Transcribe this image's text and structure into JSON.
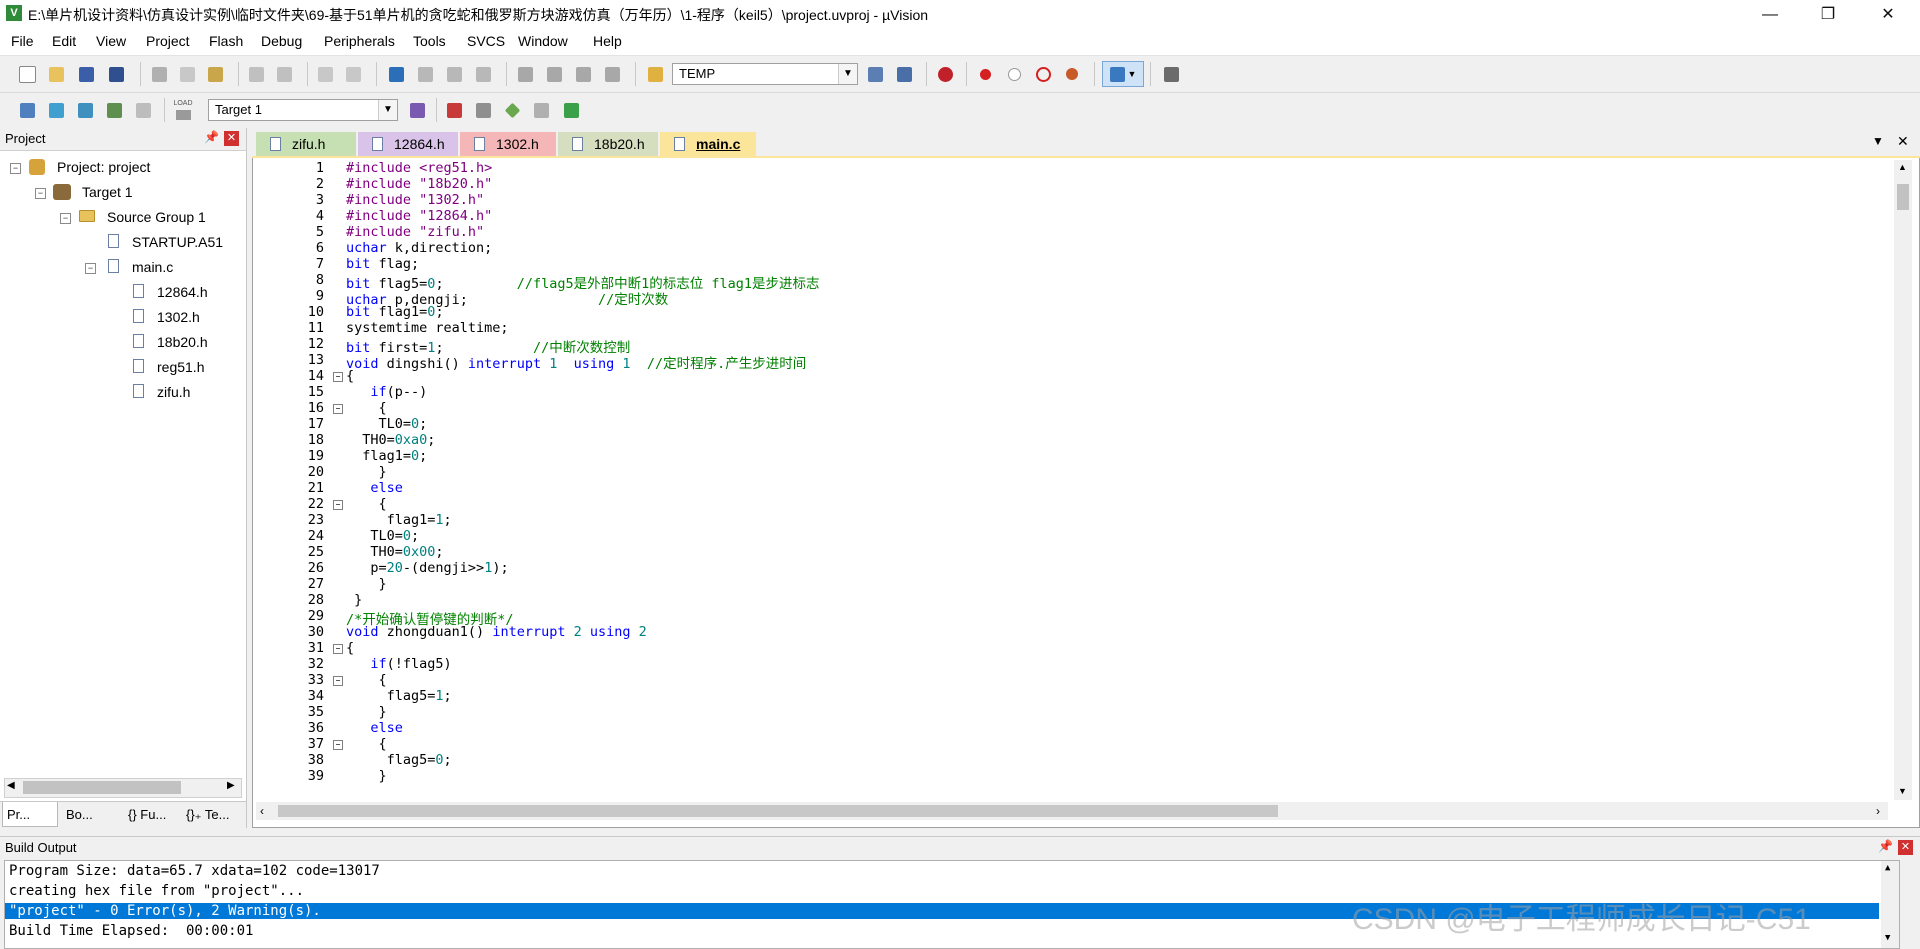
{
  "window": {
    "title": "E:\\单片机设计资料\\仿真设计实例\\临时文件夹\\69-基于51单片机的贪吃蛇和俄罗斯方块游戏仿真（万年历）\\1-程序（keil5）\\project.uvproj - µVision",
    "app_icon": "V",
    "minimize": "—",
    "maximize": "❐",
    "close": "✕"
  },
  "menu": [
    "File",
    "Edit",
    "View",
    "Project",
    "Flash",
    "Debug",
    "Peripherals",
    "Tools",
    "SVCS",
    "Window",
    "Help"
  ],
  "toolbar": {
    "find_text": "TEMP",
    "target": "Target 1",
    "load_label": "LOAD"
  },
  "project_panel": {
    "title": "Project",
    "tree": [
      {
        "label": "Project: project",
        "level": 0,
        "icon": "project-icon"
      },
      {
        "label": "Target 1",
        "level": 1,
        "icon": "target-icon"
      },
      {
        "label": "Source Group 1",
        "level": 2,
        "icon": "folder-icon"
      },
      {
        "label": "STARTUP.A51",
        "level": 3,
        "icon": "file-icon"
      },
      {
        "label": "main.c",
        "level": 3,
        "icon": "file-icon"
      },
      {
        "label": "12864.h",
        "level": 4,
        "icon": "file-icon"
      },
      {
        "label": "1302.h",
        "level": 4,
        "icon": "file-icon"
      },
      {
        "label": "18b20.h",
        "level": 4,
        "icon": "file-icon"
      },
      {
        "label": "reg51.h",
        "level": 4,
        "icon": "file-icon"
      },
      {
        "label": "zifu.h",
        "level": 4,
        "icon": "file-icon"
      }
    ],
    "bottom_tabs": [
      "Pr...",
      "Bo...",
      "{} Fu...",
      "{}₊ Te..."
    ]
  },
  "editor_tabs": [
    {
      "label": "zifu.h",
      "color": "#c6e0b4"
    },
    {
      "label": "12864.h",
      "color": "#d9c3e9"
    },
    {
      "label": "1302.h",
      "color": "#f4b6b6"
    },
    {
      "label": "18b20.h",
      "color": "#d5dfbf"
    },
    {
      "label": "main.c",
      "color": "#fbe59a",
      "active": true
    }
  ],
  "code": [
    {
      "n": "1",
      "t": "#include <reg51.h>"
    },
    {
      "n": "2",
      "t": "#include \"18b20.h\""
    },
    {
      "n": "3",
      "t": "#include \"1302.h\""
    },
    {
      "n": "4",
      "t": "#include \"12864.h\""
    },
    {
      "n": "5",
      "t": "#include \"zifu.h\""
    },
    {
      "n": "6",
      "t": "uchar k,direction;"
    },
    {
      "n": "7",
      "t": "bit flag;"
    },
    {
      "n": "8",
      "t": "bit flag5=0;         //flag5是外部中断1的标志位 flag1是步进标志"
    },
    {
      "n": "9",
      "t": "uchar p,dengji;                //定时次数"
    },
    {
      "n": "10",
      "t": "bit flag1=0;"
    },
    {
      "n": "11",
      "t": "systemtime realtime;"
    },
    {
      "n": "12",
      "t": "bit first=1;           //中断次数控制"
    },
    {
      "n": "13",
      "t": "void dingshi() interrupt 1  using 1  //定时程序.产生步进时间"
    },
    {
      "n": "14",
      "t": "{"
    },
    {
      "n": "15",
      "t": "   if(p--)"
    },
    {
      "n": "16",
      "t": "    {"
    },
    {
      "n": "17",
      "t": "    TL0=0;"
    },
    {
      "n": "18",
      "t": "  TH0=0xa0;"
    },
    {
      "n": "19",
      "t": "  flag1=0;"
    },
    {
      "n": "20",
      "t": "    }"
    },
    {
      "n": "21",
      "t": "   else"
    },
    {
      "n": "22",
      "t": "    {"
    },
    {
      "n": "23",
      "t": "     flag1=1;"
    },
    {
      "n": "24",
      "t": "   TL0=0;"
    },
    {
      "n": "25",
      "t": "   TH0=0x00;"
    },
    {
      "n": "26",
      "t": "   p=20-(dengji>>1);"
    },
    {
      "n": "27",
      "t": "    }"
    },
    {
      "n": "28",
      "t": " }"
    },
    {
      "n": "29",
      "t": "/*开始确认暂停键的判断*/"
    },
    {
      "n": "30",
      "t": "void zhongduan1() interrupt 2 using 2"
    },
    {
      "n": "31",
      "t": "{"
    },
    {
      "n": "32",
      "t": "   if(!flag5)"
    },
    {
      "n": "33",
      "t": "    {"
    },
    {
      "n": "34",
      "t": "     flag5=1;"
    },
    {
      "n": "35",
      "t": "    }"
    },
    {
      "n": "36",
      "t": "   else"
    },
    {
      "n": "37",
      "t": "    {"
    },
    {
      "n": "38",
      "t": "     flag5=0;"
    },
    {
      "n": "39",
      "t": "    }"
    }
  ],
  "build_output": {
    "title": "Build Output",
    "lines": [
      "Program Size: data=65.7 xdata=102 code=13017",
      "creating hex file from \"project\"...",
      "\"project\" - 0 Error(s), 2 Warning(s).",
      "Build Time Elapsed:  00:00:01"
    ],
    "highlight_index": 2
  },
  "watermark": "CSDN @电子工程师成长日记-C51"
}
